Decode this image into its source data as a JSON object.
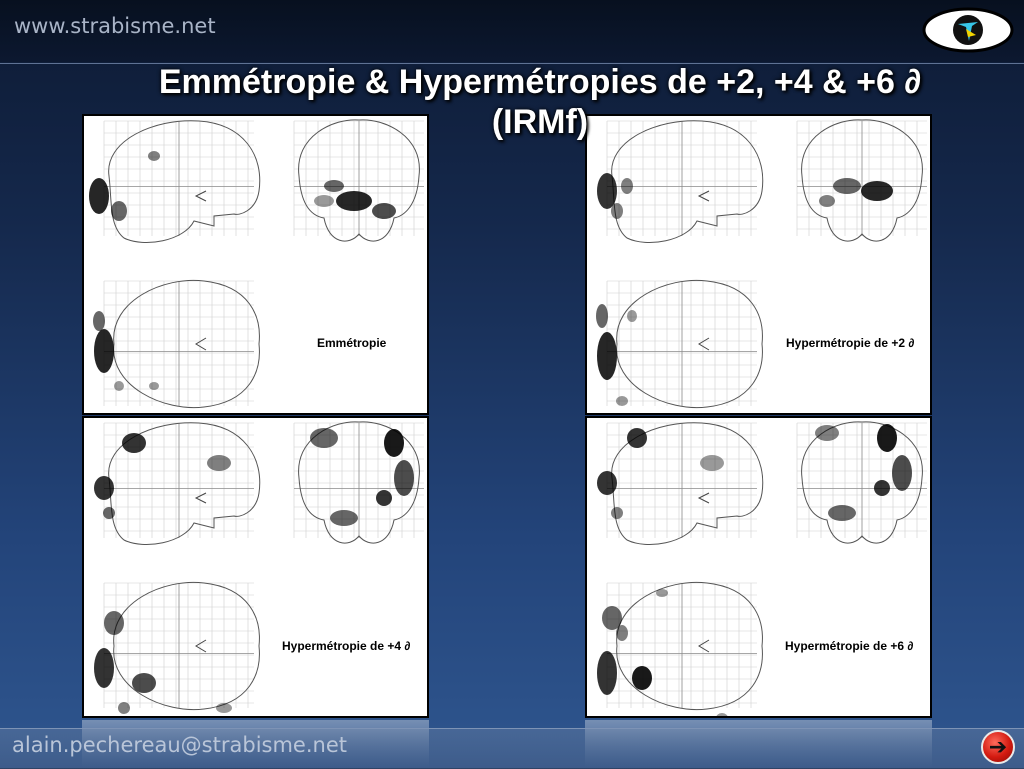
{
  "header": {
    "site_url": "www.strabisme.net",
    "logo_icon": "eye-logo-icon"
  },
  "slide": {
    "title_line1": "Emmétropie & Hypermétropies de +2, +4 & +6 ∂",
    "title_line2": "(IRMf)"
  },
  "panels": [
    {
      "label": "Emmétropie"
    },
    {
      "label": "Hypermétropie de +2 ∂"
    },
    {
      "label": "Hypermétropie de +4 ∂"
    },
    {
      "label": "Hypermétropie de +6 ∂"
    }
  ],
  "footer": {
    "email": "alain.pechereau@strabisme.net",
    "next_icon": "arrow-right-icon",
    "next_symbol": "➔"
  }
}
